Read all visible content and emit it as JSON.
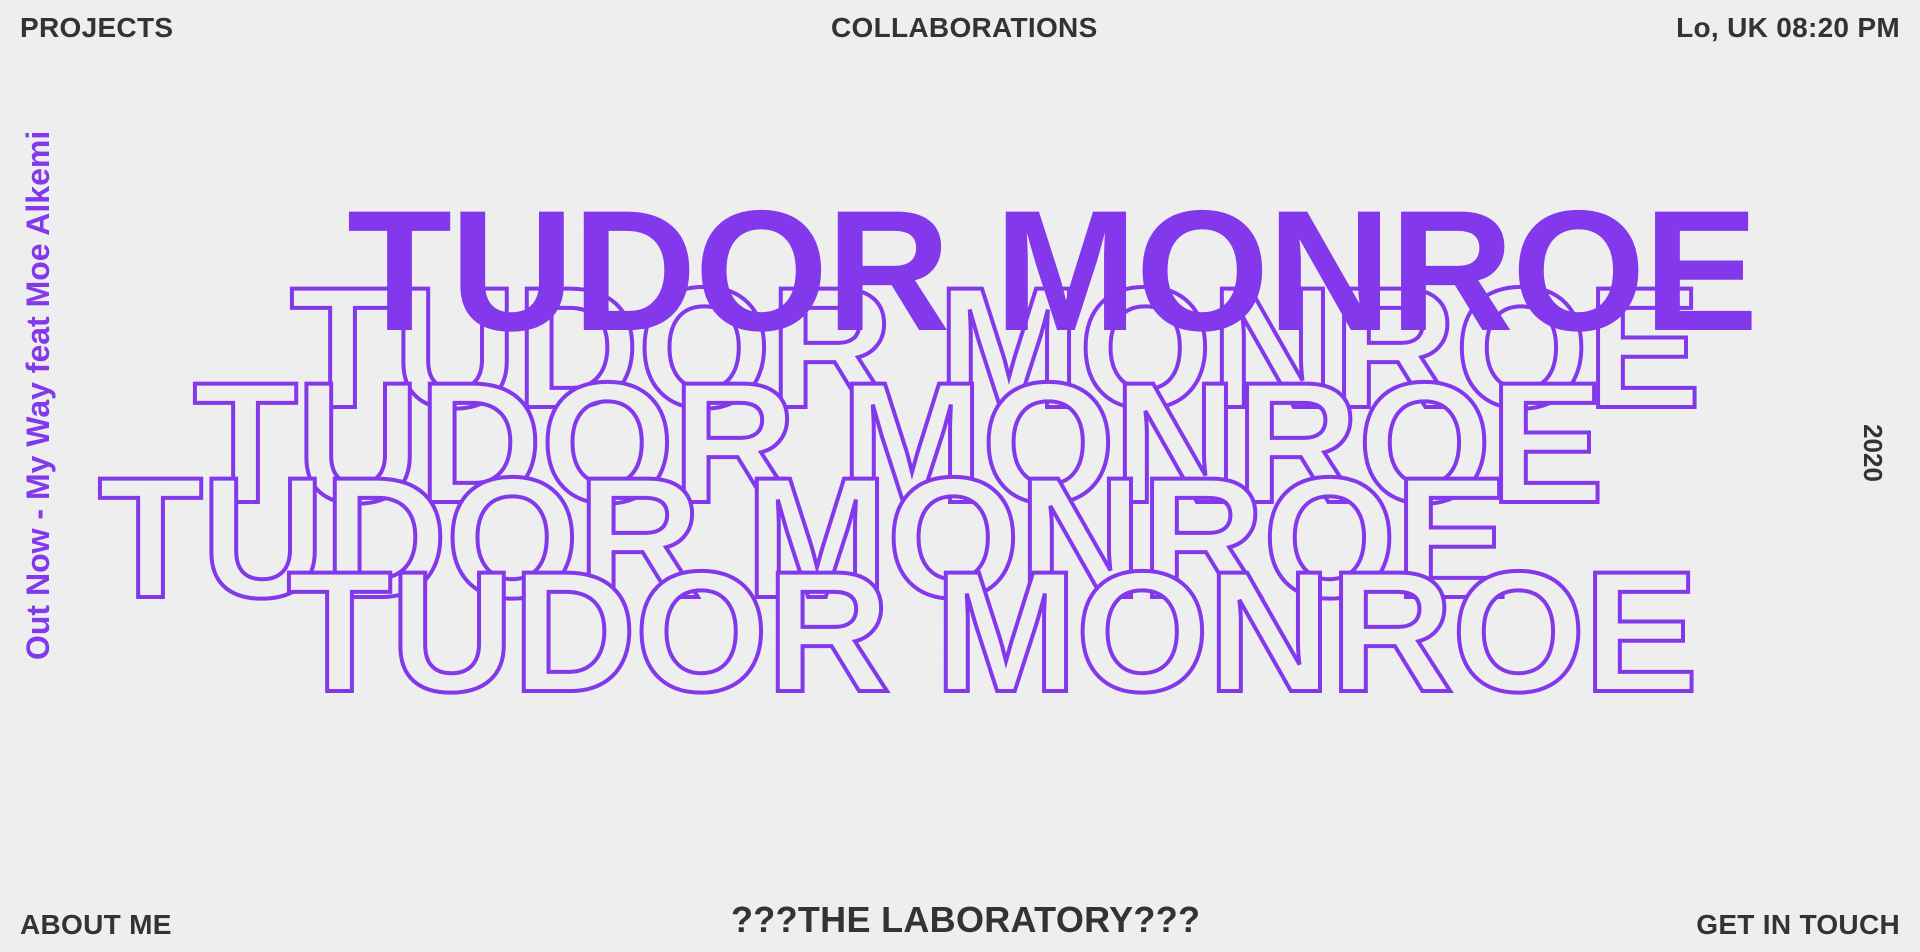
{
  "header": {
    "projects": "PROJECTS",
    "collaborations": "COLLABORATIONS",
    "location_time": "Lo, UK 08:20 PM"
  },
  "footer": {
    "about": "ABOUT ME",
    "laboratory": "???THE LABORATORY???",
    "contact": "GET IN TOUCH"
  },
  "side": {
    "announcement": "Out Now - My Way feat Moe Alkemi",
    "year": "2020"
  },
  "hero": {
    "name": "TUDOR MONROE"
  },
  "colors": {
    "accent": "#8338ec",
    "text": "#333333",
    "background": "#eeeeee"
  }
}
